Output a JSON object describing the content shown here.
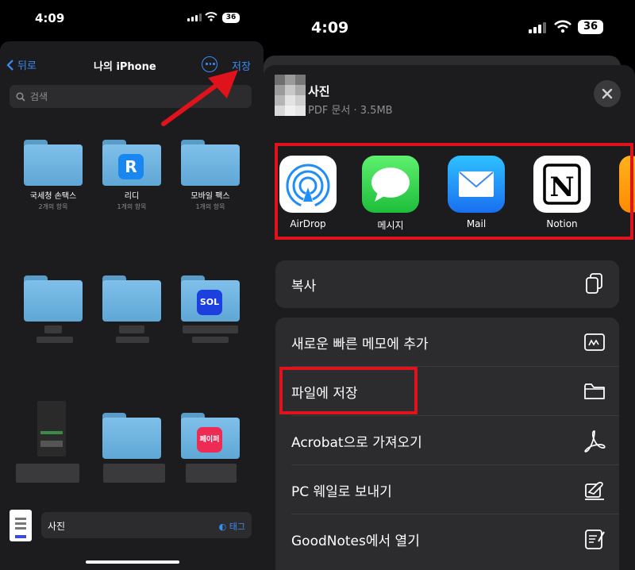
{
  "colors": {
    "accent": "#3b8cf5",
    "highlight": "#e0121b",
    "sheet": "#1c1c1e",
    "row_bg": "#2c2c2e"
  },
  "left": {
    "status": {
      "time": "4:09",
      "battery": "36"
    },
    "nav": {
      "back_label": "뒤로",
      "title": "나의 iPhone",
      "save_label": "저장",
      "more_icon": "ellipsis-circle-icon"
    },
    "search": {
      "placeholder": "검색"
    },
    "folders": [
      {
        "name": "국세청 손택스",
        "count": "2개의 항목"
      },
      {
        "name": "리디",
        "count": "1개의 항목",
        "badge": "R"
      },
      {
        "name": "모바일 팩스",
        "count": "1개의 항목"
      },
      {
        "badge": "SOL"
      },
      {
        "badge": "페이퍼"
      }
    ],
    "file": {
      "name": "사진",
      "tag_label": "태그"
    }
  },
  "right": {
    "status": {
      "time": "4:09",
      "battery": "36"
    },
    "header": {
      "title": "사진",
      "subtitle": "PDF 문서 · 3.5MB"
    },
    "apps": [
      {
        "label": "AirDrop",
        "icon": "airdrop-icon"
      },
      {
        "label": "메시지",
        "icon": "messages-icon"
      },
      {
        "label": "Mail",
        "icon": "mail-icon"
      },
      {
        "label": "Notion",
        "icon": "notion-icon",
        "glyph": "N"
      }
    ],
    "actions_top": [
      {
        "label": "복사",
        "icon": "copy-icon"
      }
    ],
    "actions": [
      {
        "label": "새로운 빠른 메모에 추가",
        "icon": "quick-note-icon"
      },
      {
        "label": "파일에 저장",
        "icon": "folder-icon"
      },
      {
        "label": "Acrobat으로 가져오기",
        "icon": "acrobat-icon"
      },
      {
        "label": "PC 웨일로 보내기",
        "icon": "whale-icon"
      },
      {
        "label": "GoodNotes에서 열기",
        "icon": "goodnotes-icon"
      }
    ]
  }
}
